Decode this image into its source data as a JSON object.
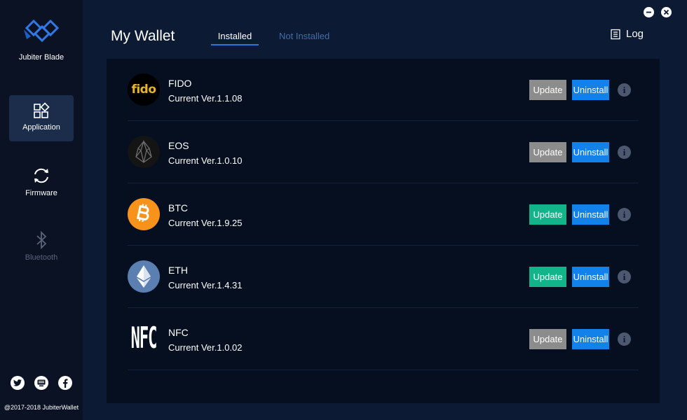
{
  "app": {
    "brand_name": "Jubiter Blade"
  },
  "sidebar": {
    "items": [
      {
        "label": "Application",
        "icon": "application-icon",
        "active": true
      },
      {
        "label": "Firmware",
        "icon": "refresh-icon",
        "active": false
      },
      {
        "label": "Bluetooth",
        "icon": "bluetooth-icon",
        "active": false,
        "disabled": true
      }
    ],
    "social": [
      "twitter-icon",
      "chat-icon",
      "facebook-icon"
    ],
    "copyright": "@2017-2018 JubiterWallet"
  },
  "header": {
    "title": "My Wallet",
    "tabs": [
      {
        "label": "Installed",
        "selected": true
      },
      {
        "label": "Not Installed",
        "selected": false
      }
    ],
    "log_label": "Log"
  },
  "apps": [
    {
      "name": "FIDO",
      "version": "Current Ver.1.1.08",
      "update_label": "Update",
      "update_enabled": false,
      "uninstall_label": "Uninstall",
      "logo_text": "fido"
    },
    {
      "name": "EOS",
      "version": "Current Ver.1.0.10",
      "update_label": "Update",
      "update_enabled": false,
      "uninstall_label": "Uninstall"
    },
    {
      "name": "BTC",
      "version": "Current Ver.1.9.25",
      "update_label": "Update",
      "update_enabled": true,
      "uninstall_label": "Uninstall"
    },
    {
      "name": "ETH",
      "version": "Current Ver.1.4.31",
      "update_label": "Update",
      "update_enabled": true,
      "uninstall_label": "Uninstall"
    },
    {
      "name": "NFC",
      "version": "Current Ver.1.0.02",
      "update_label": "Update",
      "update_enabled": false,
      "uninstall_label": "Uninstall",
      "logo_text": "NFC"
    }
  ],
  "colors": {
    "update_enabled": "#11b589",
    "update_disabled": "#8c8c8c",
    "uninstall": "#1281ea",
    "accent": "#2a78d6"
  }
}
